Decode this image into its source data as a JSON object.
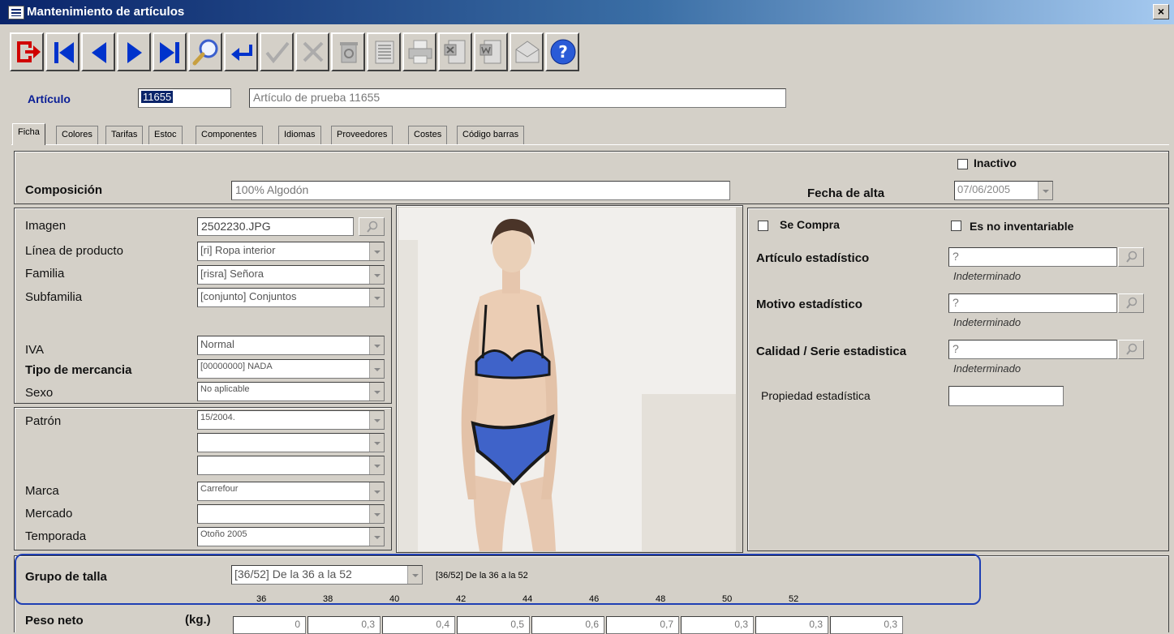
{
  "window": {
    "title": "Mantenimiento de artículos",
    "close_label": "×"
  },
  "toolbar": [
    {
      "icon": "exit-icon"
    },
    {
      "icon": "first-record-icon"
    },
    {
      "icon": "previous-record-icon"
    },
    {
      "icon": "next-record-icon"
    },
    {
      "icon": "last-record-icon"
    },
    {
      "icon": "search-icon"
    },
    {
      "icon": "return-icon"
    },
    {
      "icon": "accept-icon"
    },
    {
      "icon": "cancel-icon"
    },
    {
      "icon": "delete-icon"
    },
    {
      "icon": "list-icon"
    },
    {
      "icon": "print-icon"
    },
    {
      "icon": "excel-export-icon"
    },
    {
      "icon": "word-export-icon"
    },
    {
      "icon": "email-icon"
    },
    {
      "icon": "help-icon"
    }
  ],
  "article": {
    "label": "Artículo",
    "code": "11655",
    "description": "Artículo de prueba 11655"
  },
  "tabs": [
    "Ficha",
    "Colores",
    "Tarifas",
    "Estoc",
    "Componentes",
    "Idiomas",
    "Proveedores",
    "Costes",
    "Código barras"
  ],
  "ficha": {
    "composicion": {
      "label": "Composición",
      "value": "100% Algodón"
    },
    "inactivo_label": "Inactivo",
    "fecha_alta": {
      "label": "Fecha de alta",
      "value": "07/06/2005"
    },
    "imagen": {
      "label": "Imagen",
      "value": "2502230.JPG"
    },
    "linea": {
      "label": "Línea de producto",
      "value": "[ri] Ropa interior"
    },
    "familia": {
      "label": "Familia",
      "value": "[risra] Señora"
    },
    "subfamilia": {
      "label": "Subfamilia",
      "value": "[conjunto] Conjuntos"
    },
    "iva": {
      "label": "IVA",
      "value": "Normal"
    },
    "tipo_mercancia": {
      "label": "Tipo de mercancia",
      "value": "[00000000] NADA"
    },
    "sexo": {
      "label": "Sexo",
      "value": "No aplicable"
    },
    "patron": {
      "label": "Patrón",
      "value": "15/2004."
    },
    "marca": {
      "label": "Marca",
      "value": "Carrefour"
    },
    "mercado": {
      "label": "Mercado",
      "value": ""
    },
    "temporada": {
      "label": "Temporada",
      "value": "Otoño 2005"
    },
    "se_compra_label": "Se Compra",
    "no_inventariable_label": "Es no inventariable",
    "articulo_estadistico": {
      "label": "Artículo estadístico",
      "value": "?",
      "note": "Indeterminado"
    },
    "motivo_estadistico": {
      "label": "Motivo estadístico",
      "value": "?",
      "note": "Indeterminado"
    },
    "calidad_serie": {
      "label": "Calidad / Serie estadistica",
      "value": "?",
      "note": "Indeterminado"
    },
    "propiedad_estadistica": {
      "label": "Propiedad estadística",
      "value": ""
    },
    "grupo_talla": {
      "label": "Grupo de talla",
      "value": "[36/52] De la 36 a la 52",
      "display": "[36/52] De la 36 a la 52"
    },
    "tallas": [
      "36",
      "38",
      "40",
      "42",
      "44",
      "46",
      "48",
      "50",
      "52"
    ],
    "peso_neto": {
      "label": "Peso neto",
      "unit": "(kg.)",
      "values": [
        "0",
        "0,3",
        "0,4",
        "0,5",
        "0,6",
        "0,7",
        "0,3",
        "0,3",
        "0,3"
      ]
    }
  },
  "colors": {
    "accent_blue": "#0a1e96",
    "highlight": "#1f3fb4"
  }
}
